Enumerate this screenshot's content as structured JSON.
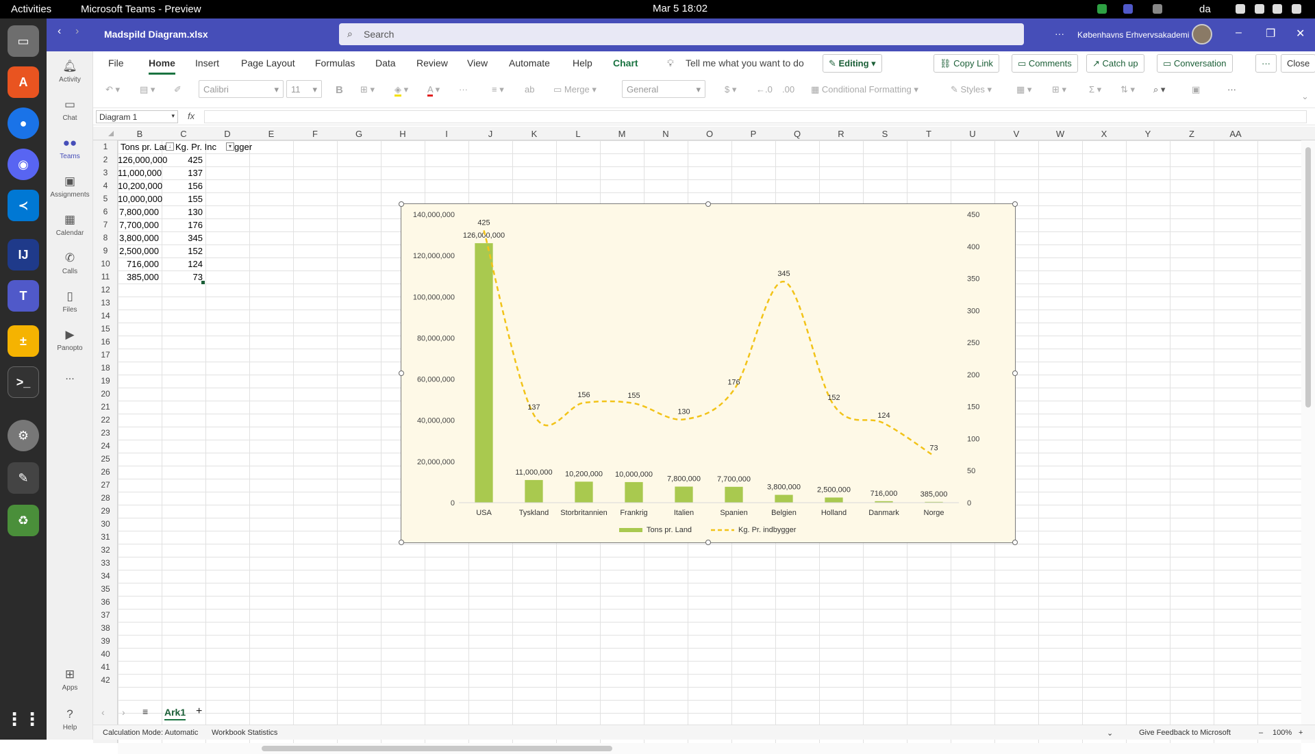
{
  "system": {
    "activities": "Activities",
    "window_title": "Microsoft Teams - Preview",
    "clock": "Mar 5  18:02",
    "language": "da"
  },
  "titlebar": {
    "file_name": "Madspild Diagram.xlsx",
    "search_placeholder": "Search",
    "more": "···",
    "org": "Københavns Erhvervsakademi"
  },
  "rail": {
    "items": [
      {
        "label": "Activity",
        "icon": "bell-icon"
      },
      {
        "label": "Chat",
        "icon": "chat-icon"
      },
      {
        "label": "Teams",
        "icon": "teams-icon"
      },
      {
        "label": "Assignments",
        "icon": "assignments-icon"
      },
      {
        "label": "Calendar",
        "icon": "calendar-icon"
      },
      {
        "label": "Calls",
        "icon": "phone-icon"
      },
      {
        "label": "Files",
        "icon": "files-icon"
      },
      {
        "label": "Panopto",
        "icon": "panopto-icon"
      },
      {
        "label": "...",
        "icon": "more-icon"
      },
      {
        "label": "Apps",
        "icon": "apps-icon"
      },
      {
        "label": "Help",
        "icon": "help-icon"
      }
    ]
  },
  "ribbon": {
    "tabs": [
      "File",
      "Home",
      "Insert",
      "Page Layout",
      "Formulas",
      "Data",
      "Review",
      "View",
      "Automate",
      "Help",
      "Chart"
    ],
    "tell_me": "Tell me what you want to do",
    "editing": "Editing",
    "copy_link": "Copy Link",
    "comments": "Comments",
    "catch_up": "Catch up",
    "conversation": "Conversation",
    "more": "···",
    "close": "Close"
  },
  "toolbar": {
    "font": "Calibri",
    "size": "11",
    "bold": "B",
    "merge": "Merge",
    "number_format": "General",
    "currency": "$",
    "conditional": "Conditional Formatting",
    "styles": "Styles"
  },
  "formula_bar": {
    "name_box": "Diagram 1",
    "fx": "fx"
  },
  "columns": [
    "B",
    "C",
    "D",
    "E",
    "F",
    "G",
    "H",
    "I",
    "J",
    "K",
    "L",
    "M",
    "N",
    "O",
    "P",
    "Q",
    "R",
    "S",
    "T",
    "U",
    "V",
    "W",
    "X",
    "Y",
    "Z",
    "AA"
  ],
  "rows": [
    "1",
    "2",
    "3",
    "4",
    "5",
    "6",
    "7",
    "8",
    "9",
    "10",
    "11",
    "12",
    "13",
    "14",
    "15",
    "16",
    "17",
    "18",
    "19",
    "20",
    "21",
    "22",
    "23",
    "24",
    "25",
    "26",
    "27",
    "28",
    "29",
    "30",
    "31",
    "32",
    "33",
    "34",
    "35",
    "36",
    "37",
    "38",
    "39",
    "40",
    "41",
    "42"
  ],
  "sheet": {
    "header_b": "Tons pr. Lan",
    "header_c": "Kg. Pr. Inc",
    "header_overflow": "gger",
    "col_b": [
      "126,000,000",
      "11,000,000",
      "10,200,000",
      "10,000,000",
      "7,800,000",
      "7,700,000",
      "3,800,000",
      "2,500,000",
      "716,000",
      "385,000"
    ],
    "col_c": [
      "425",
      "137",
      "156",
      "155",
      "130",
      "176",
      "345",
      "152",
      "124",
      "73"
    ]
  },
  "chart_data": {
    "type": "bar",
    "categories": [
      "USA",
      "Tyskland",
      "Storbritannien",
      "Frankrig",
      "Italien",
      "Spanien",
      "Belgien",
      "Holland",
      "Danmark",
      "Norge"
    ],
    "series": [
      {
        "name": "Tons pr. Land",
        "type": "bar",
        "axis": "left",
        "color": "#a9c94f",
        "values": [
          126000000,
          11000000,
          10200000,
          10000000,
          7800000,
          7700000,
          3800000,
          2500000,
          716000,
          385000
        ],
        "labels": [
          "126,000,000",
          "11,000,000",
          "10,200,000",
          "10,000,000",
          "7,800,000",
          "7,700,000",
          "3,800,000",
          "2,500,000",
          "716,000",
          "385,000"
        ]
      },
      {
        "name": "Kg. Pr. indbygger",
        "type": "line",
        "axis": "right",
        "color": "#f2c318",
        "dashed": true,
        "smooth": true,
        "values": [
          425,
          137,
          156,
          155,
          130,
          176,
          345,
          152,
          124,
          73
        ]
      }
    ],
    "y_left": {
      "min": 0,
      "max": 140000000,
      "ticks": [
        "0",
        "20,000,000",
        "40,000,000",
        "60,000,000",
        "80,000,000",
        "100,000,000",
        "120,000,000",
        "140,000,000"
      ]
    },
    "y_right": {
      "min": 0,
      "max": 450,
      "ticks": [
        "0",
        "50",
        "100",
        "150",
        "200",
        "250",
        "300",
        "350",
        "400",
        "450"
      ]
    },
    "legend": "bottom",
    "grid": false
  },
  "sheetbar": {
    "tab": "Ark1",
    "add": "+"
  },
  "status": {
    "calc": "Calculation Mode: Automatic",
    "stats": "Workbook Statistics",
    "feedback": "Give Feedback to Microsoft",
    "zoom": "100%"
  }
}
